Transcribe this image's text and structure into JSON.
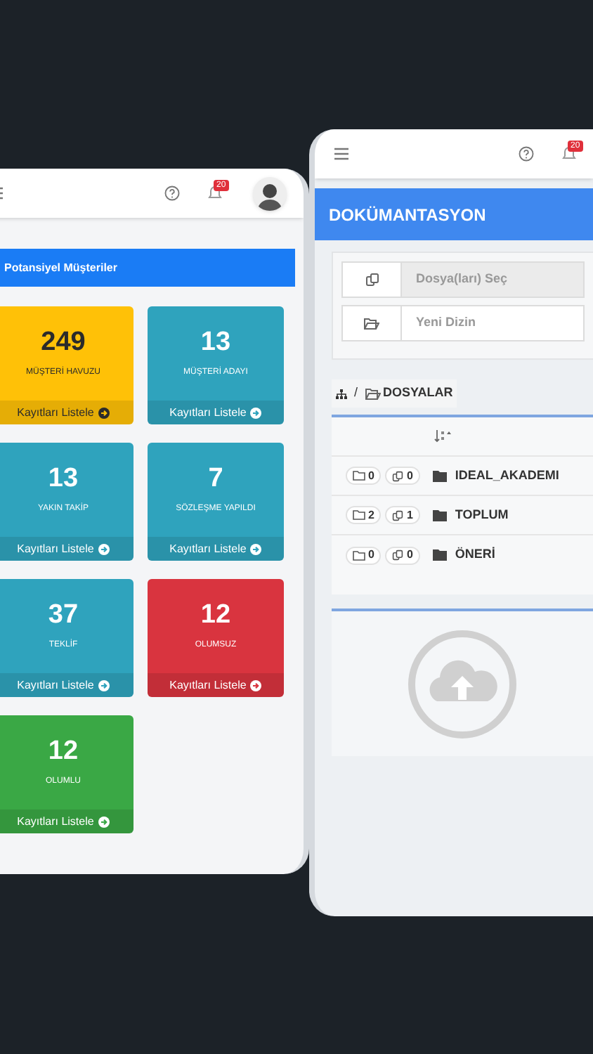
{
  "left_screen": {
    "notification_count": "20",
    "panel_title": "Potansiyel Müşteriler",
    "tiles": [
      {
        "count": "249",
        "label": "MÜŞTERİ HAVUZU",
        "link": "Kayıtları Listele",
        "color": "#ffc107"
      },
      {
        "count": "13",
        "label": "MÜŞTERİ ADAYI",
        "link": "Kayıtları Listele",
        "color": "#2fa3bd"
      },
      {
        "count": "13",
        "label": "YAKIN TAKİP",
        "link": "Kayıtları Listele",
        "color": "#2fa3bd"
      },
      {
        "count": "7",
        "label": "SÖZLEŞME YAPILDI",
        "link": "Kayıtları Listele",
        "color": "#2fa3bd"
      },
      {
        "count": "37",
        "label": "TEKLİF",
        "link": "Kayıtları Listele",
        "color": "#2fa3bd"
      },
      {
        "count": "12",
        "label": "OLUMSUZ",
        "link": "Kayıtları Listele",
        "color": "#d9343f"
      },
      {
        "count": "12",
        "label": "OLUMLU",
        "link": "Kayıtları Listele",
        "color": "#3aa845"
      }
    ]
  },
  "right_screen": {
    "notification_count": "20",
    "title": "DOKÜMANTASYON",
    "fields": [
      {
        "kind": "file",
        "placeholder": "Dosya(ları) Seç"
      },
      {
        "kind": "folder",
        "placeholder": "Yeni Dizin"
      }
    ],
    "breadcrumb_separator": "/",
    "breadcrumb": "DOSYALAR",
    "folders": [
      {
        "folder_count": "0",
        "file_count": "0",
        "name": "IDEAL_AKADEMI"
      },
      {
        "folder_count": "2",
        "file_count": "1",
        "name": "TOPLUM"
      },
      {
        "folder_count": "0",
        "file_count": "0",
        "name": "ÖNERİ"
      }
    ]
  }
}
